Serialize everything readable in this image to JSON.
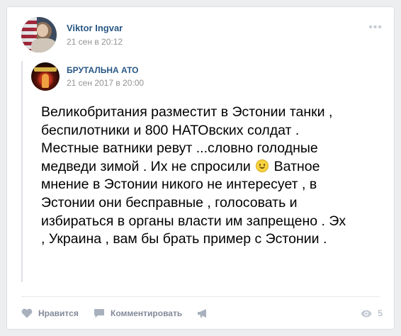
{
  "post": {
    "author": "Viktor Ingvar",
    "date": "21 сен в 20:12",
    "more_menu": "•••"
  },
  "repost": {
    "source_name": "БРУТАЛЬНА АТО",
    "date": "21 сен 2017 в 20:00",
    "text_part1": "Великобритания разместит в Эстонии танки , беспилотники и 800 НАТОвских солдат . Местные ватники ревут ...словно голодные медведи зимой . Их не спросили",
    "text_part2": "Ватное мнение в Эстонии никого не интересует , в Эстонии они бесправные , голосовать и избираться в органы власти им запрещено . Эх , Украина , вам бы брать пример с Эстонии ."
  },
  "actions": {
    "like_label": "Нравится",
    "comment_label": "Комментировать",
    "views_count": "5"
  },
  "icons": {
    "like": "heart-icon",
    "comment": "comment-icon",
    "share": "megaphone-icon",
    "views": "eye-icon",
    "emoji": "smile-emoji-icon"
  },
  "colors": {
    "link": "#2a5885",
    "meta": "#939393",
    "action": "#828a99",
    "background": "#edeef0"
  }
}
